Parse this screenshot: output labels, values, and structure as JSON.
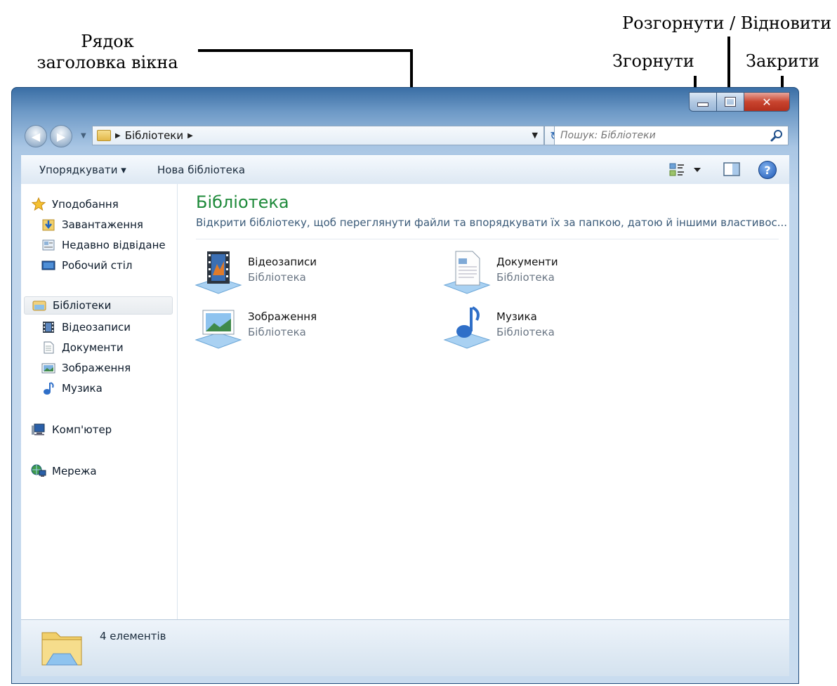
{
  "annotations": {
    "title_bar": "Рядок заголовка вікна",
    "maximize_restore": "Розгорнути / Відновити",
    "minimize": "Згорнути",
    "close": "Закрити"
  },
  "window": {
    "address_path": "Бібліотеки",
    "search_placeholder": "Пошук: Бібліотеки",
    "close_glyph": "✕"
  },
  "toolbar": {
    "organize_label": "Упорядкувати",
    "new_library_label": "Нова бібліотека",
    "help_glyph": "?"
  },
  "sidebar": {
    "favorites": {
      "label": "Уподобання",
      "items": [
        {
          "label": "Завантаження",
          "icon": "downloads-icon"
        },
        {
          "label": "Недавно відвідане",
          "icon": "recent-places-icon"
        },
        {
          "label": "Робочий стіл",
          "icon": "desktop-icon"
        }
      ]
    },
    "libraries": {
      "label": "Бібліотеки",
      "items": [
        {
          "label": "Відеозаписи",
          "icon": "videos-icon"
        },
        {
          "label": "Документи",
          "icon": "documents-icon"
        },
        {
          "label": "Зображення",
          "icon": "pictures-icon"
        },
        {
          "label": "Музика",
          "icon": "music-icon"
        }
      ]
    },
    "computer": {
      "label": "Комп'ютер",
      "icon": "computer-icon"
    },
    "network": {
      "label": "Мережа",
      "icon": "network-icon"
    }
  },
  "main": {
    "title": "Бібліотека",
    "description": "Відкрити бібліотеку, щоб переглянути файли та впорядкувати їх за папкою, датою й іншими властивос...",
    "libraries": [
      {
        "name": "Відеозаписи",
        "type": "Бібліотека",
        "icon": "videos-library-icon"
      },
      {
        "name": "Документи",
        "type": "Бібліотека",
        "icon": "documents-library-icon"
      },
      {
        "name": "Зображення",
        "type": "Бібліотека",
        "icon": "pictures-library-icon"
      },
      {
        "name": "Музика",
        "type": "Бібліотека",
        "icon": "music-library-icon"
      }
    ]
  },
  "status": {
    "item_count": "4 елементів"
  },
  "colors": {
    "library_title": "#1e8a3a",
    "close_button": "#c9442f",
    "titlebar": "#bfd5ec"
  }
}
